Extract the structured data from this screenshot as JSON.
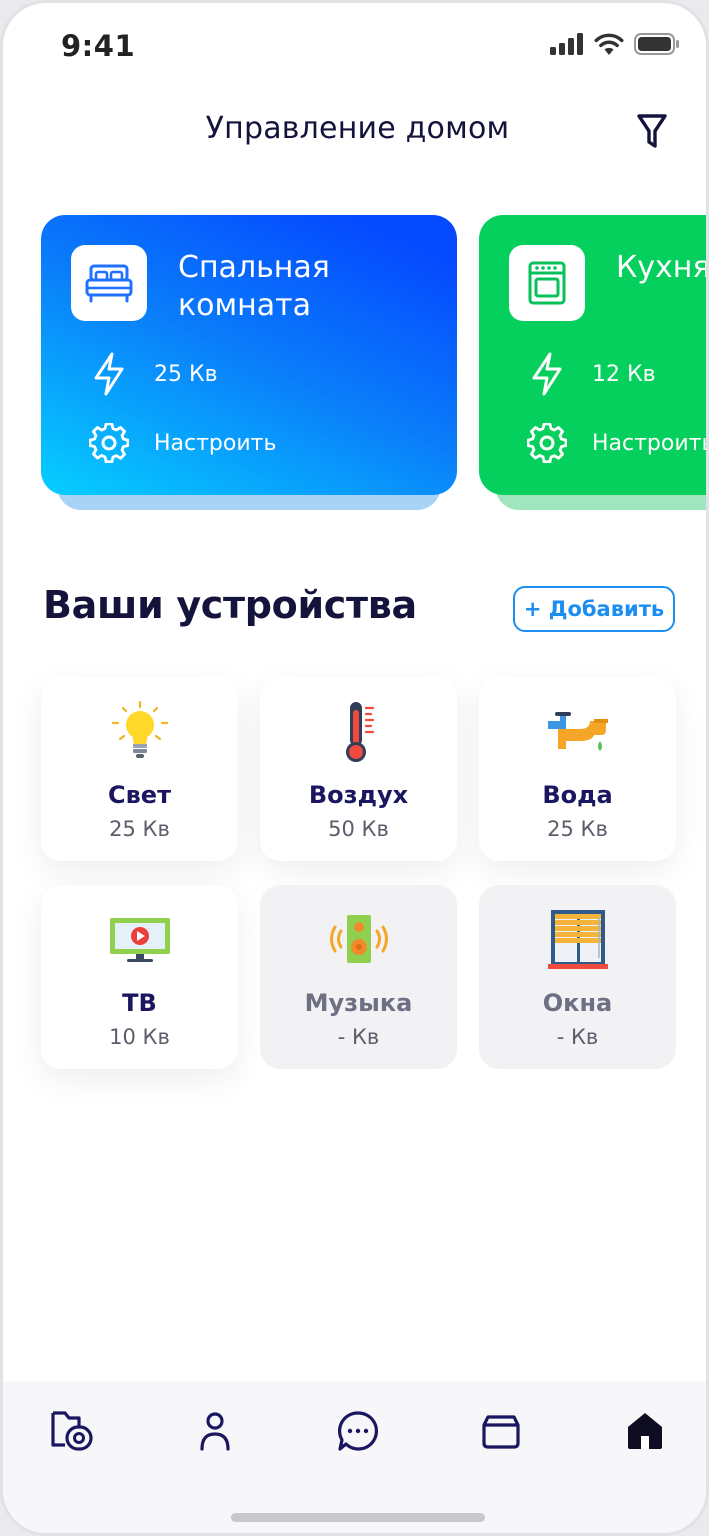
{
  "status_bar": {
    "time": "9:41"
  },
  "header": {
    "title": "Управление домом"
  },
  "rooms": [
    {
      "name": "Спальная\nкомната",
      "power": "25 Кв",
      "settings_label": "Настроить",
      "color": "#0a6bff"
    },
    {
      "name": "Кухня",
      "power": "12 Кв",
      "settings_label": "Настроить",
      "color": "#06d05d"
    }
  ],
  "devices": {
    "title": "Ваши устройства",
    "add_label": "+ Добавить",
    "items": [
      {
        "name": "Свет",
        "value": "25 Кв",
        "icon": "lightbulb-icon",
        "active": true
      },
      {
        "name": "Воздух",
        "value": "50 Кв",
        "icon": "thermometer-icon",
        "active": true
      },
      {
        "name": "Вода",
        "value": "25 Кв",
        "icon": "faucet-icon",
        "active": true
      },
      {
        "name": "ТВ",
        "value": "10 Кв",
        "icon": "tv-icon",
        "active": true
      },
      {
        "name": "Музыка",
        "value": "- Кв",
        "icon": "speaker-icon",
        "active": false
      },
      {
        "name": "Окна",
        "value": "- Кв",
        "icon": "window-blinds-icon",
        "active": false
      }
    ]
  },
  "nav": {
    "items": [
      "camera-folder-icon",
      "profile-icon",
      "chat-icon",
      "box-icon",
      "home-icon"
    ],
    "active": "home-icon"
  },
  "colors": {
    "accent": "#1c8ef2",
    "text_dark": "#14133b",
    "device_name": "#1a1660"
  }
}
